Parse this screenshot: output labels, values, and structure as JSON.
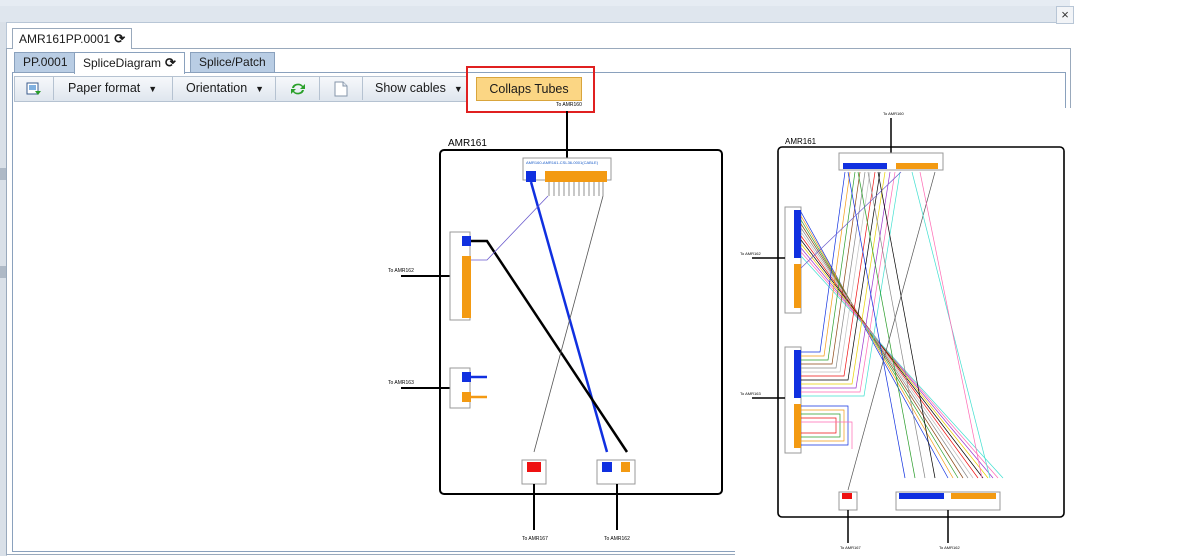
{
  "window": {
    "close_glyph": "×"
  },
  "tabs": {
    "outer_tab_label": "AMR161PP.0001",
    "refresh_glyph": "⟳",
    "inner": [
      {
        "label": "PP.0001"
      },
      {
        "label": "SpliceDiagram"
      },
      {
        "label": "Splice/Patch"
      }
    ]
  },
  "toolbar": {
    "paper_format": "Paper format",
    "orientation": "Orientation",
    "show_cables": "Show cables",
    "collaps_tubes": "Collaps Tubes",
    "caret": "▼"
  },
  "diagram_left": {
    "closure_title": "AMR161",
    "top_label": "To AMR160",
    "left_label_1": "To AMR162",
    "left_label_2": "To AMR163",
    "bottom_label_1": "To AMR167",
    "bottom_label_2": "To AMR162",
    "top_cable_name": "AMR160-AMR161-CSL36-0001(CABLE)"
  },
  "diagram_right": {
    "closure_title": "AMR161",
    "top_label": "To AMR160",
    "left_label_1": "To AMR162",
    "left_label_2": "To AMR163",
    "bottom_label_1": "To AMR167",
    "bottom_label_2": "To AMR162"
  },
  "colors": {
    "tube_blue": "#1030e0",
    "tube_orange": "#f39a12",
    "fiber_red": "#ee1111",
    "highlight": "#e02020",
    "collaps_bg": "#fbd684"
  }
}
